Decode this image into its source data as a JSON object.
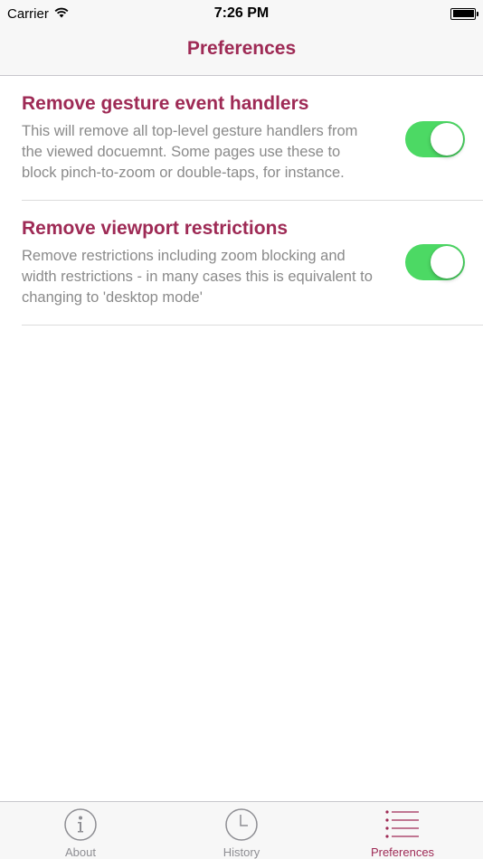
{
  "status_bar": {
    "carrier": "Carrier",
    "time": "7:26 PM"
  },
  "nav": {
    "title": "Preferences"
  },
  "preferences": [
    {
      "title": "Remove gesture event handlers",
      "description": "This will remove all top-level gesture handlers from the viewed docuemnt.  Some pages use these to block pinch-to-zoom or double-taps, for instance.",
      "enabled": true
    },
    {
      "title": "Remove viewport restrictions",
      "description": "Remove restrictions including zoom blocking and width restrictions - in many cases this is equivalent to changing to 'desktop mode'",
      "enabled": true
    }
  ],
  "tabs": [
    {
      "label": "About",
      "icon": "info-icon",
      "active": false
    },
    {
      "label": "History",
      "icon": "clock-icon",
      "active": false
    },
    {
      "label": "Preferences",
      "icon": "list-icon",
      "active": true
    }
  ],
  "colors": {
    "accent": "#9e2a55",
    "toggle_on": "#4cd964",
    "secondary_text": "#8a8a8a",
    "tab_inactive": "#8e8e93"
  }
}
